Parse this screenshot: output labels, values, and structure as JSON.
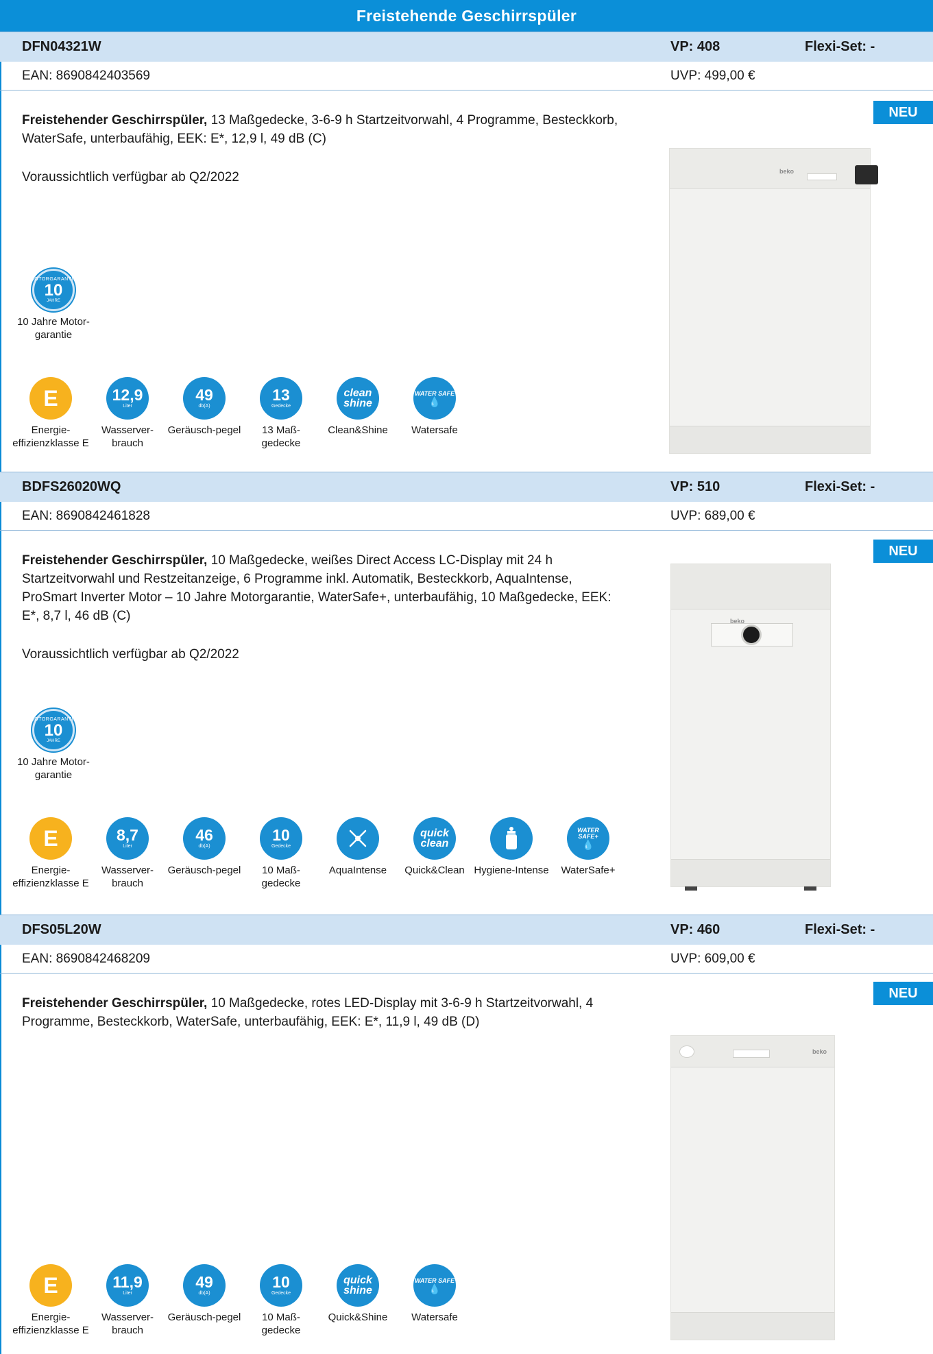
{
  "page_title": "Freistehende Geschirrspüler",
  "products": [
    {
      "model": "DFN04321W",
      "vp": "VP: 408",
      "flexi": "Flexi-Set: -",
      "ean": "EAN: 8690842403569",
      "uvp": "UVP: 499,00 €",
      "badge": "NEU",
      "desc_bold": "Freistehender Geschirrspüler,",
      "desc_rest": " 13 Maßgedecke, 3-6-9 h Startzeitvorwahl, 4 Programme, Besteckkorb, WaterSafe, unterbaufähig, EEK: E*, 12,9 l, 49 dB (C)",
      "availability": "Voraussichtlich verfügbar ab Q2/2022",
      "warranty": {
        "top": "MOTORGARANTIE",
        "num": "10",
        "bottom": "JAHRE",
        "label": "10 Jahre Motor-garantie"
      },
      "icons": [
        {
          "icon": "energy-class-icon",
          "value": "E",
          "unit": "",
          "label": "Energie-effizienzklasse E"
        },
        {
          "icon": "water-consumption-icon",
          "value": "12,9",
          "unit": "Liter",
          "label": "Wasserver-brauch"
        },
        {
          "icon": "noise-level-icon",
          "value": "49",
          "unit": "db(A)",
          "label": "Geräusch-pegel"
        },
        {
          "icon": "place-settings-icon",
          "value": "13",
          "unit": "Gedecke",
          "label": "13 Maß-gedecke"
        },
        {
          "icon": "clean-shine-icon",
          "value": "clean shine",
          "unit": "",
          "label": "Clean&Shine"
        },
        {
          "icon": "watersafe-icon",
          "value": "WATER SAFE",
          "unit": "",
          "label": "Watersafe"
        }
      ]
    },
    {
      "model": "BDFS26020WQ",
      "vp": "VP: 510",
      "flexi": "Flexi-Set: -",
      "ean": "EAN: 8690842461828",
      "uvp": "UVP: 689,00 €",
      "badge": "NEU",
      "desc_bold": "Freistehender Geschirrspüler,",
      "desc_rest": " 10 Maßgedecke, weißes Direct Access LC-Display mit 24 h Startzeitvorwahl und Restzeitanzeige, 6 Programme inkl. Automatik, Besteckkorb, AquaIntense, ProSmart Inverter Motor – 10 Jahre Motorgarantie, WaterSafe+, unterbaufähig, 10 Maßgedecke, EEK: E*, 8,7 l, 46 dB (C)",
      "availability": "Voraussichtlich verfügbar ab Q2/2022",
      "warranty": {
        "top": "MOTORGARANTIE",
        "num": "10",
        "bottom": "JAHRE",
        "label": "10 Jahre Motor-garantie"
      },
      "icons": [
        {
          "icon": "energy-class-icon",
          "value": "E",
          "unit": "",
          "label": "Energie-effizienzklasse E"
        },
        {
          "icon": "water-consumption-icon",
          "value": "8,7",
          "unit": "Liter",
          "label": "Wasserver-brauch"
        },
        {
          "icon": "noise-level-icon",
          "value": "46",
          "unit": "db(A)",
          "label": "Geräusch-pegel"
        },
        {
          "icon": "place-settings-icon",
          "value": "10",
          "unit": "Gedecke",
          "label": "10 Maß-gedecke"
        },
        {
          "icon": "aquaintense-icon",
          "value": "",
          "unit": "",
          "label": "AquaIntense"
        },
        {
          "icon": "quick-clean-icon",
          "value": "quick clean",
          "unit": "",
          "label": "Quick&Clean"
        },
        {
          "icon": "hygiene-intense-icon",
          "value": "",
          "unit": "",
          "label": "Hygiene-Intense"
        },
        {
          "icon": "watersafe-plus-icon",
          "value": "WATER SAFE+",
          "unit": "",
          "label": "WaterSafe+"
        }
      ]
    },
    {
      "model": "DFS05L20W",
      "vp": "VP: 460",
      "flexi": "Flexi-Set: -",
      "ean": "EAN: 8690842468209",
      "uvp": "UVP: 609,00 €",
      "badge": "NEU",
      "desc_bold": "Freistehender Geschirrspüler,",
      "desc_rest": " 10 Maßgedecke, rotes LED-Display mit 3-6-9 h Startzeitvorwahl, 4 Programme, Besteckkorb, WaterSafe, unterbaufähig, EEK: E*, 11,9 l, 49 dB (D)",
      "availability": "",
      "icons": [
        {
          "icon": "energy-class-icon",
          "value": "E",
          "unit": "",
          "label": "Energie-effizienzklasse E"
        },
        {
          "icon": "water-consumption-icon",
          "value": "11,9",
          "unit": "Liter",
          "label": "Wasserver-brauch"
        },
        {
          "icon": "noise-level-icon",
          "value": "49",
          "unit": "db(A)",
          "label": "Geräusch-pegel"
        },
        {
          "icon": "place-settings-icon",
          "value": "10",
          "unit": "Gedecke",
          "label": "10 Maß-gedecke"
        },
        {
          "icon": "quick-shine-icon",
          "value": "quick shine",
          "unit": "",
          "label": "Quick&Shine"
        },
        {
          "icon": "watersafe-icon",
          "value": "WATER SAFE",
          "unit": "",
          "label": "Watersafe"
        }
      ]
    }
  ],
  "colors": {
    "brand_blue": "#0b8fd8",
    "header_band": "#cfe2f3",
    "energy_orange": "#f7b21e",
    "icon_blue": "#1b8fd2"
  }
}
